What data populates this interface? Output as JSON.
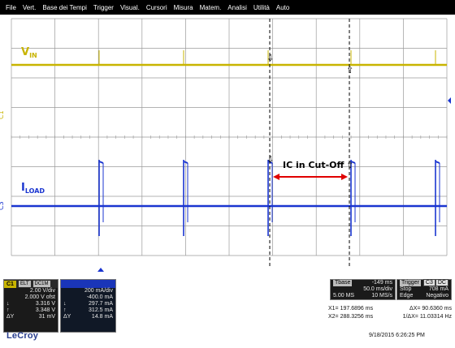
{
  "menu": [
    "File",
    "Vert.",
    "Base dei Tempi",
    "Trigger",
    "Visual.",
    "Cursori",
    "Misura",
    "Matem.",
    "Analisi",
    "Utilità",
    "Auto"
  ],
  "screen": {
    "vin_label_main": "V",
    "vin_label_sub": "IN",
    "iload_label_main": "I",
    "iload_label_sub": "LOAD",
    "cutoff_label": "IC in Cut-Off",
    "c1_marker": "C1",
    "c3_marker": "C3"
  },
  "colors": {
    "grid_bg": "#ffffff",
    "vin_trace": "#c8b400",
    "iload_trace": "#1a35d0",
    "arrow": "#e00000",
    "grid_line": "#9a9a9a"
  },
  "channel1": {
    "tag": "C1",
    "mini_tags": [
      "ELT",
      "DC1M"
    ],
    "vdiv": "2.00 V/div",
    "offset": "2.000 V ofst",
    "cursor1": "3.316 V",
    "cursor2": "3.348 V",
    "delta": "31 mV"
  },
  "channel3": {
    "vdiv": "200 mA/div",
    "offset": "-400.0 mA",
    "cursor1": "297.7 mA",
    "cursor2": "312.5 mA",
    "delta": "14.8 mA"
  },
  "timebase": {
    "tag": "Tbase",
    "delay": "-149 ms",
    "tdiv": "50.0 ms/div",
    "samples": "5.00 MS",
    "rate": "10 MS/s"
  },
  "trigger": {
    "tag": "Trigger",
    "chan_tags": [
      "C3",
      "DC"
    ],
    "mode": "Stop",
    "level": "708 mA",
    "type": "Edge",
    "slope": "Negativo"
  },
  "cursors": {
    "x1_label": "X1=",
    "x1": "197.6896 ms",
    "dx_label": "ΔX=",
    "dx": "90.6360 ms",
    "x2_label": "X2=",
    "x2": "288.3256 ms",
    "inv_dx_label": "1/ΔX=",
    "inv_dx": "11.03314 Hz"
  },
  "symbols": {
    "down_arrow": "↓",
    "up_arrow": "↑",
    "delta_y": "ΔY"
  },
  "brand": "LeCroy",
  "timestamp": "9/18/2015 6:26:25 PM"
}
